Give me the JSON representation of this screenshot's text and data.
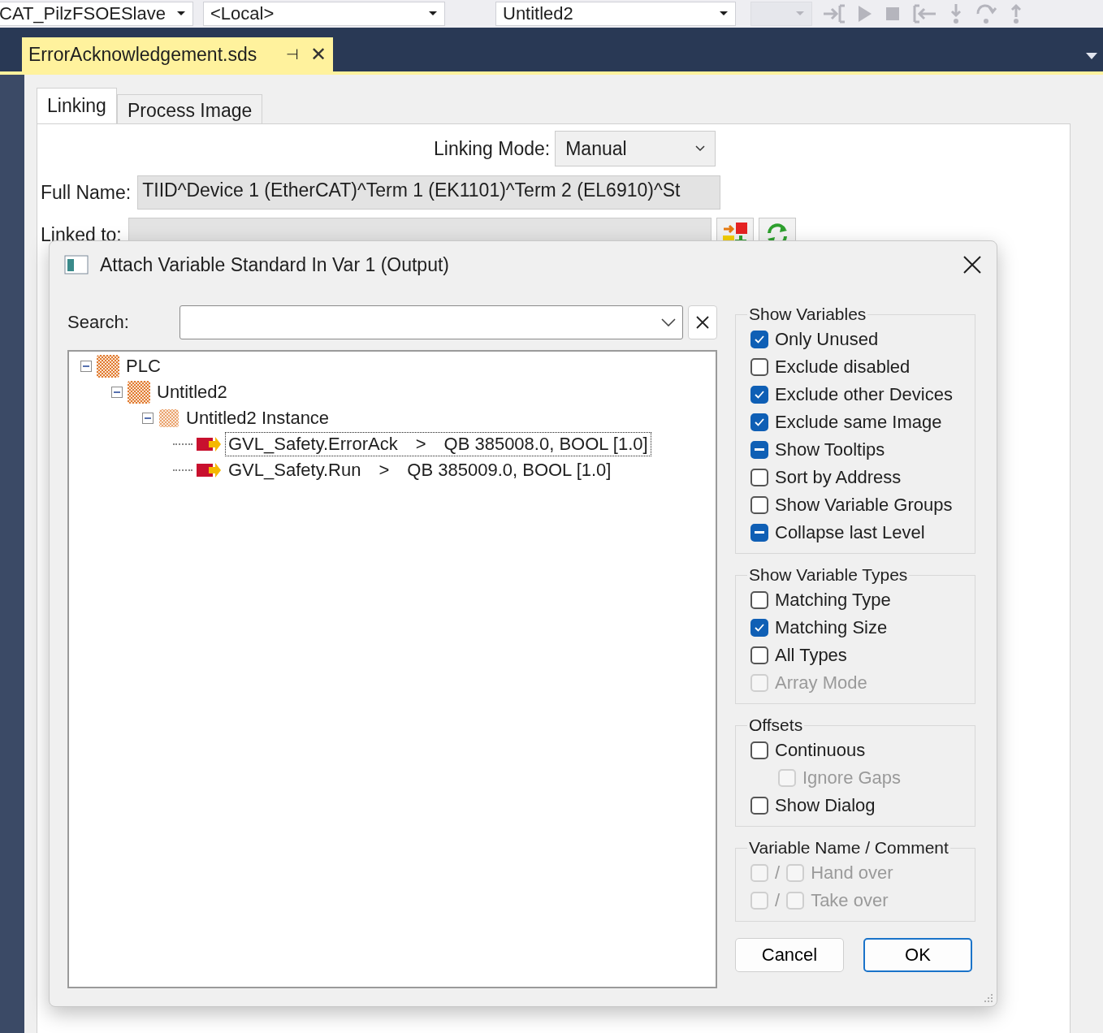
{
  "toolbar": {
    "combos": [
      {
        "value": "CAT_PilzFSOESlave",
        "disabled": false
      },
      {
        "value": "<Local>",
        "disabled": false
      },
      {
        "value": "Untitled2",
        "disabled": false
      },
      {
        "disabled": true
      }
    ]
  },
  "document_tab": {
    "title": "ErrorAcknowledgement.sds",
    "pin": "⊣",
    "close": "✕"
  },
  "tabs": [
    {
      "label": "Linking",
      "selected": true
    },
    {
      "label": "Process Image",
      "selected": false
    }
  ],
  "linking_mode": {
    "label": "Linking Mode:",
    "value": "Manual"
  },
  "full_name": {
    "label": "Full Name:",
    "value": "TIID^Device 1 (EtherCAT)^Term 1 (EK1101)^Term 2 (EL6910)^St"
  },
  "linked_to": {
    "label": "Linked to:"
  },
  "dialog": {
    "title": "Attach Variable Standard In Var 1 (Output)",
    "search": {
      "label": "Search:"
    },
    "tree": [
      {
        "label": "PLC",
        "kind": "folder",
        "expanded": true,
        "children": [
          {
            "label": "Untitled2",
            "kind": "folder",
            "expanded": true,
            "children": [
              {
                "label": "Untitled2 Instance",
                "kind": "instance",
                "expanded": true,
                "children": [
                  {
                    "label": "GVL_Safety.ErrorAck",
                    "kind": "variable",
                    "arrow": ">",
                    "address": "QB 385008.0, BOOL [1.0]",
                    "selected": true
                  },
                  {
                    "label": "GVL_Safety.Run",
                    "kind": "variable",
                    "arrow": ">",
                    "address": "QB 385009.0, BOOL [1.0]",
                    "selected": false
                  }
                ]
              }
            ]
          }
        ]
      }
    ],
    "groups": [
      {
        "title": "Show Variables",
        "items": [
          {
            "kind": "single",
            "label": "Only Unused",
            "checked": true,
            "mixed": false,
            "disabled": false
          },
          {
            "kind": "single",
            "label": "Exclude disabled",
            "checked": false,
            "mixed": false,
            "disabled": false
          },
          {
            "kind": "single",
            "label": "Exclude other Devices",
            "checked": true,
            "mixed": false,
            "disabled": false
          },
          {
            "kind": "single",
            "label": "Exclude same Image",
            "checked": true,
            "mixed": false,
            "disabled": false
          },
          {
            "kind": "single",
            "label": "Show Tooltips",
            "checked": true,
            "mixed": true,
            "disabled": false
          },
          {
            "kind": "single",
            "label": "Sort by Address",
            "checked": false,
            "mixed": false,
            "disabled": false
          },
          {
            "kind": "single",
            "label": "Show Variable Groups",
            "checked": false,
            "mixed": false,
            "disabled": false
          },
          {
            "kind": "single",
            "label": "Collapse last Level",
            "checked": true,
            "mixed": true,
            "disabled": false
          }
        ]
      },
      {
        "title": "Show Variable Types",
        "items": [
          {
            "kind": "single",
            "label": "Matching Type",
            "checked": false,
            "mixed": false,
            "disabled": false
          },
          {
            "kind": "single",
            "label": "Matching Size",
            "checked": true,
            "mixed": false,
            "disabled": false
          },
          {
            "kind": "single",
            "label": "All Types",
            "checked": false,
            "mixed": false,
            "disabled": false
          },
          {
            "kind": "single",
            "label": "Array Mode",
            "checked": false,
            "mixed": false,
            "disabled": true
          }
        ]
      },
      {
        "title": "Offsets",
        "items": [
          {
            "kind": "single",
            "label": "Continuous",
            "checked": false,
            "mixed": false,
            "disabled": false
          },
          {
            "kind": "indented",
            "label": "Ignore Gaps",
            "checked": false,
            "mixed": false,
            "disabled": true
          },
          {
            "kind": "single",
            "label": "Show Dialog",
            "checked": false,
            "mixed": false,
            "disabled": false
          }
        ]
      },
      {
        "title": "Variable Name / Comment",
        "items": [
          {
            "kind": "pair",
            "label": "Hand over",
            "separator": "/",
            "checks": [
              false,
              false
            ],
            "disabled": true
          },
          {
            "kind": "pair",
            "label": "Take over",
            "separator": "/",
            "checks": [
              false,
              false
            ],
            "disabled": true
          }
        ]
      }
    ],
    "buttons": [
      {
        "label": "Cancel",
        "default": false
      },
      {
        "label": "OK",
        "default": true
      }
    ]
  }
}
